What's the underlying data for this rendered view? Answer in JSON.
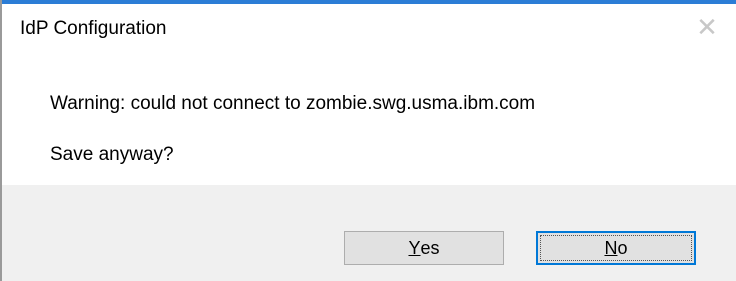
{
  "dialog": {
    "title": "IdP Configuration",
    "close_glyph": "✕",
    "message": "Warning: could not connect to zombie.swg.usma.ibm.com",
    "question": "Save anyway?",
    "buttons": {
      "yes": {
        "mnemonic": "Y",
        "rest": "es"
      },
      "no": {
        "mnemonic": "N",
        "rest": "o"
      }
    },
    "default_button": "no"
  },
  "colors": {
    "accent_border": "#0078d7",
    "footer_bg": "#f0f0f0",
    "button_bg": "#e1e1e1"
  },
  "icons": {
    "close": "close-icon"
  }
}
